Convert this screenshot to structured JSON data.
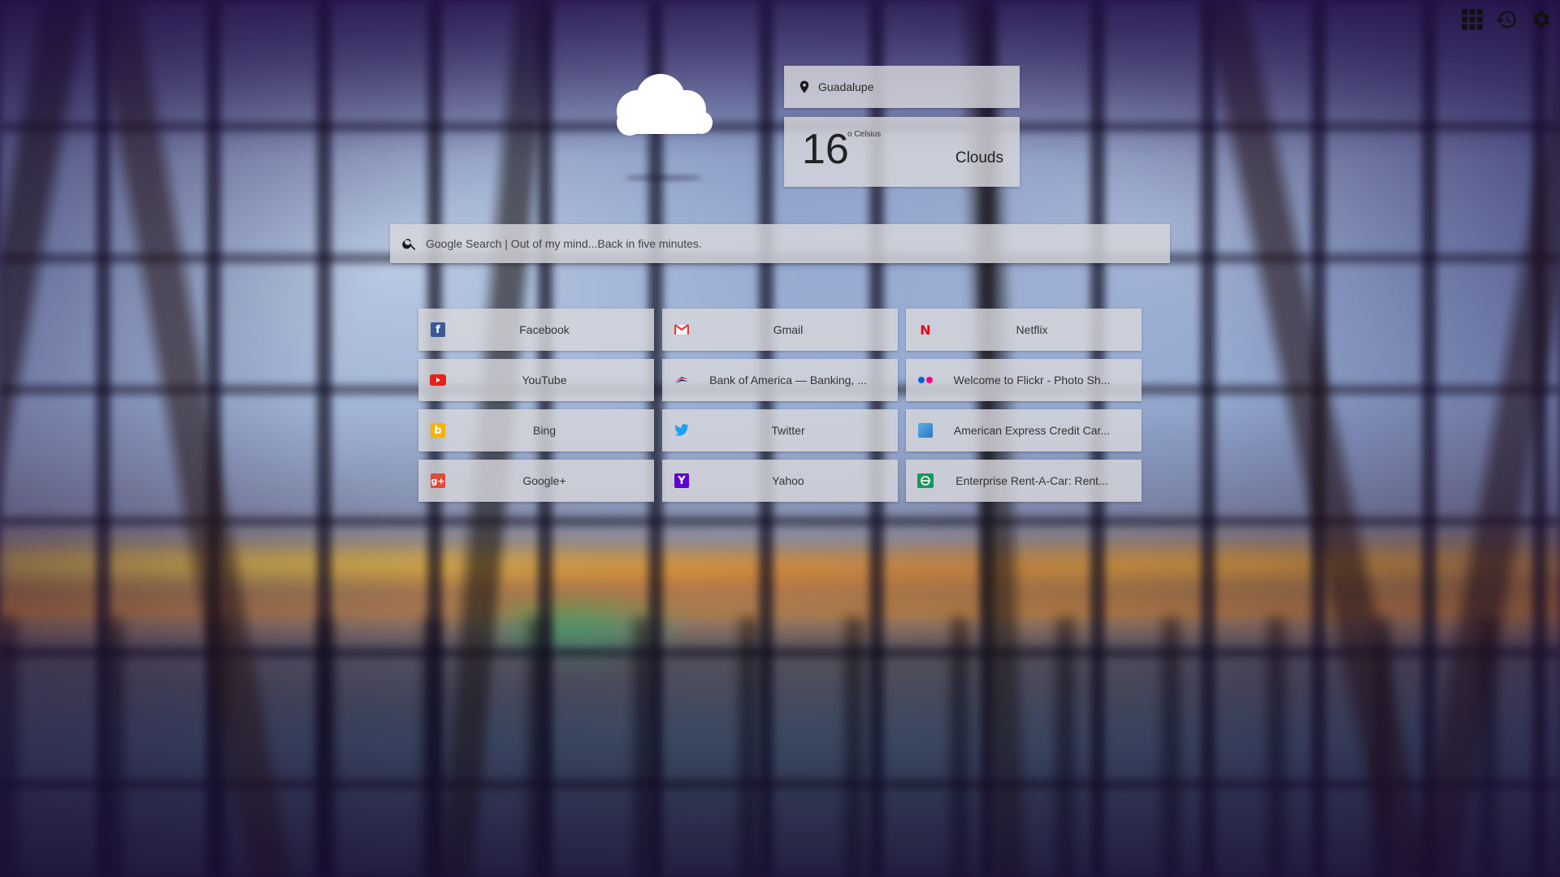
{
  "toolbar": {
    "apps_icon": "grid-icon",
    "history_icon": "history-icon",
    "settings_icon": "gear-icon"
  },
  "weather": {
    "condition_icon": "cloud-icon",
    "location": "Guadalupe",
    "temperature": "16",
    "unit": "o Celsius",
    "condition": "Clouds"
  },
  "search": {
    "placeholder": "Google Search | Out of my mind...Back in five minutes."
  },
  "tiles": [
    {
      "label": "Facebook",
      "icon": "facebook-icon",
      "color": "#3b5998"
    },
    {
      "label": "Gmail",
      "icon": "gmail-icon",
      "color": "#d44638"
    },
    {
      "label": "Netflix",
      "icon": "netflix-icon",
      "color": "#e50914"
    },
    {
      "label": "YouTube",
      "icon": "youtube-icon",
      "color": "#e62117"
    },
    {
      "label": "Bank of America — Banking, ...",
      "icon": "bank-of-america-icon",
      "color": "#c8102e"
    },
    {
      "label": "Welcome to Flickr - Photo Sh...",
      "icon": "flickr-icon",
      "color": "#0063dc"
    },
    {
      "label": "Bing",
      "icon": "bing-icon",
      "color": "#f4b400"
    },
    {
      "label": "Twitter",
      "icon": "twitter-icon",
      "color": "#1da1f2"
    },
    {
      "label": "American Express Credit Car...",
      "icon": "amex-icon",
      "color": "#2e77bc"
    },
    {
      "label": "Google+",
      "icon": "google-plus-icon",
      "color": "#dd4b39"
    },
    {
      "label": "Yahoo",
      "icon": "yahoo-icon",
      "color": "#5f01d1"
    },
    {
      "label": "Enterprise Rent-A-Car: Rent...",
      "icon": "enterprise-icon",
      "color": "#169a5a"
    }
  ]
}
